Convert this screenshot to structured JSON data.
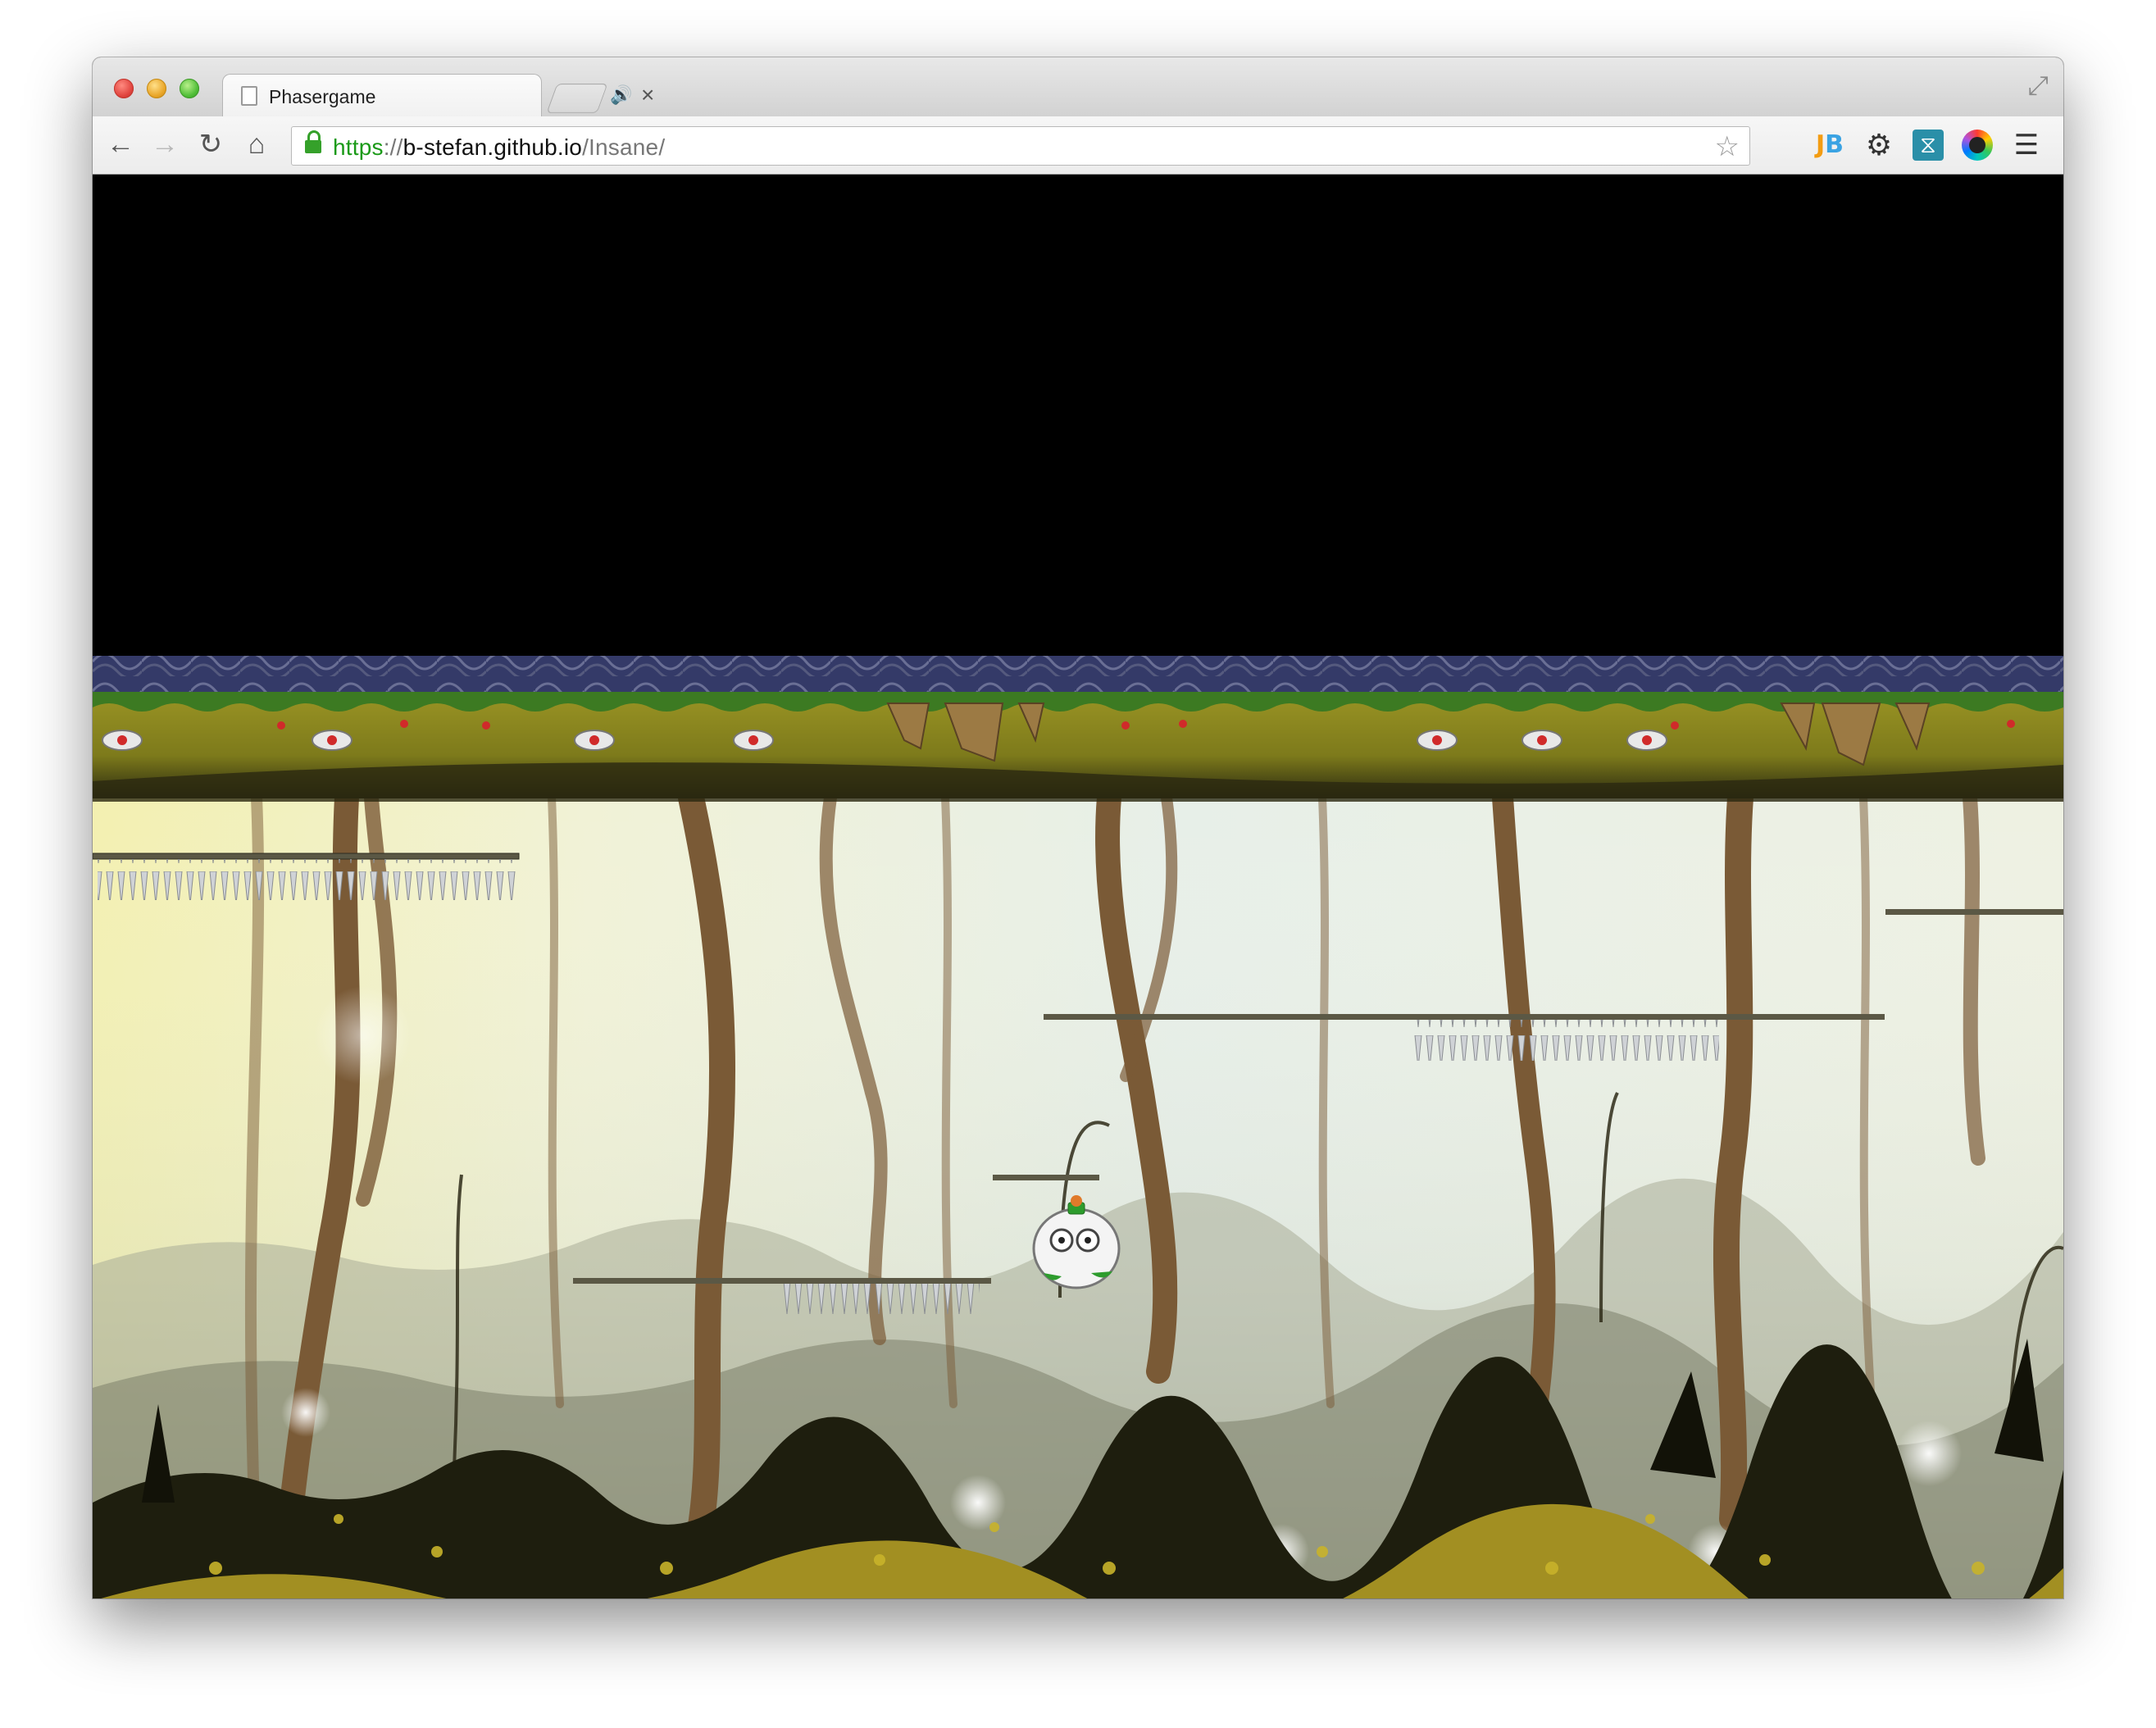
{
  "browser": {
    "tab": {
      "title": "Phasergame"
    },
    "url": {
      "scheme": "https",
      "separator": "://",
      "host": "b-stefan.github.io",
      "path": "/Insane/"
    },
    "extensions": [
      "jb-extension-icon",
      "gear-icon",
      "wave-extension-icon",
      "color-picker-icon",
      "menu-icon"
    ]
  },
  "game": {
    "engine_canvas": "phaser-game-canvas",
    "colors": {
      "sky": "#000000",
      "ground": "#8e8a1f",
      "mist": "#eef3e0",
      "tree": "#7a5a36",
      "bush": "#1e1e0e"
    }
  }
}
